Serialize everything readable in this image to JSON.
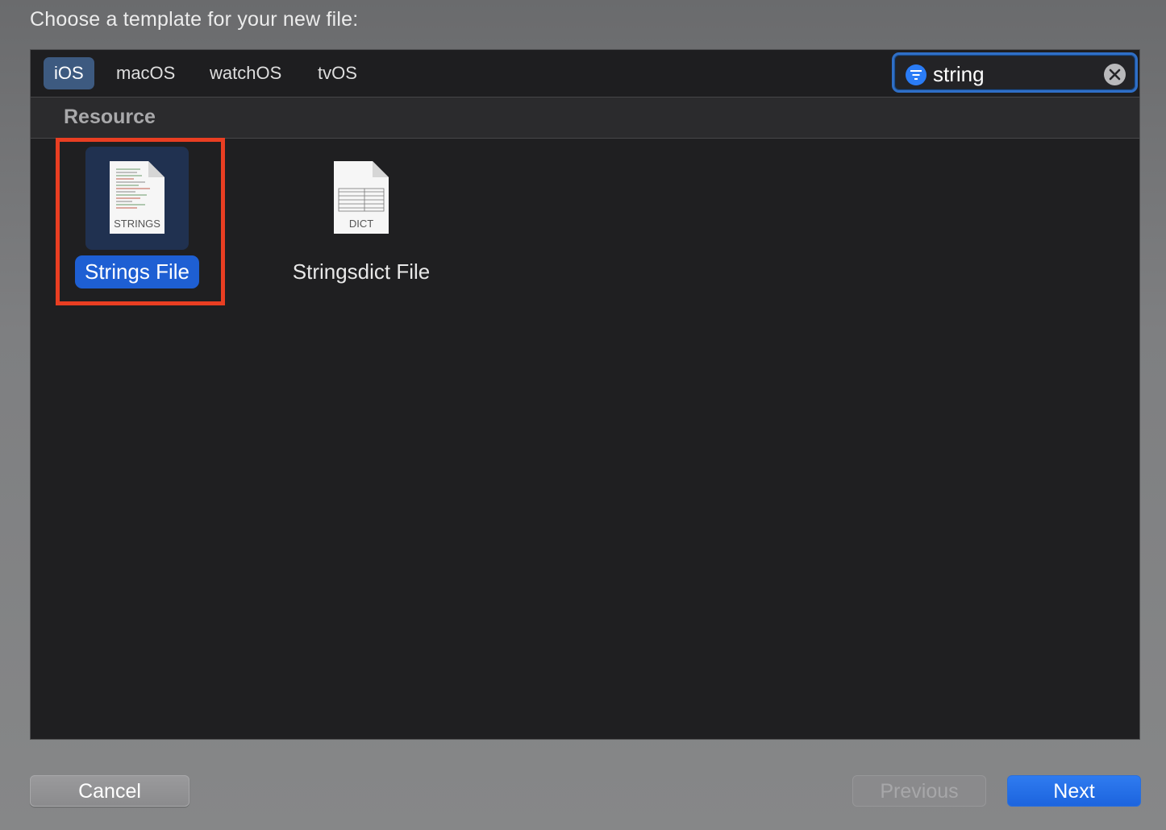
{
  "prompt": "Choose a template for your new file:",
  "tabs": [
    {
      "label": "iOS",
      "active": true
    },
    {
      "label": "macOS",
      "active": false
    },
    {
      "label": "watchOS",
      "active": false
    },
    {
      "label": "tvOS",
      "active": false
    }
  ],
  "search": {
    "value": "string"
  },
  "section": {
    "title": "Resource"
  },
  "templates": [
    {
      "name": "Strings File",
      "icon_label": "STRINGS",
      "icon": "strings-file-icon",
      "selected": true
    },
    {
      "name": "Stringsdict File",
      "icon_label": "DICT",
      "icon": "dict-file-icon",
      "selected": false
    }
  ],
  "buttons": {
    "cancel": "Cancel",
    "previous": "Previous",
    "next": "Next"
  },
  "colors": {
    "accent": "#1e5fd3",
    "highlight": "#e93e22",
    "panel": "#1f1f21"
  }
}
